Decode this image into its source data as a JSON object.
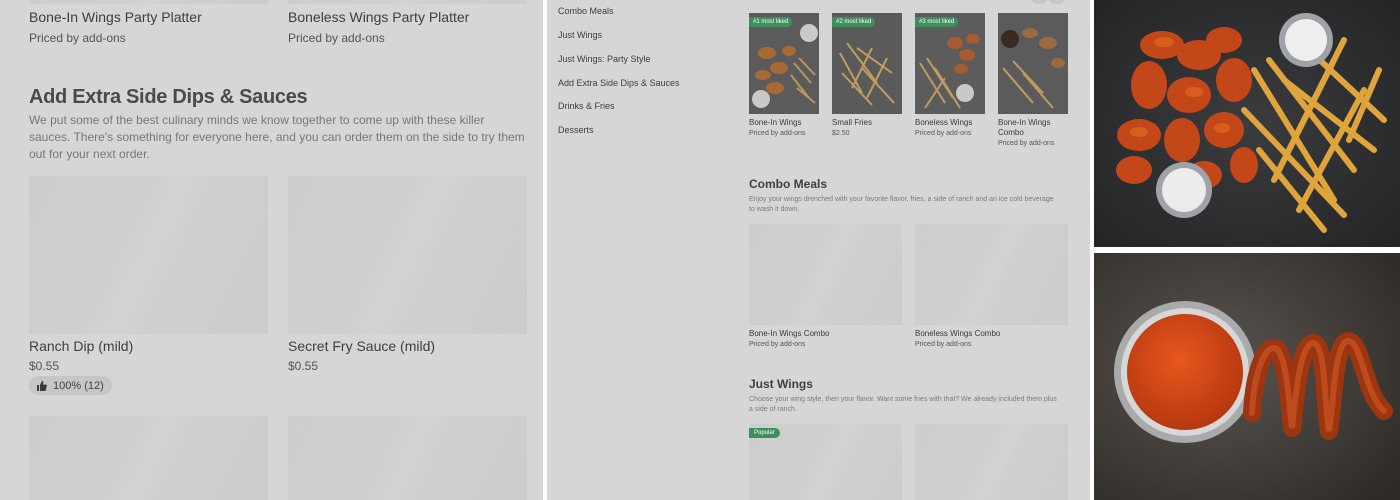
{
  "panel_a": {
    "top_items": [
      {
        "name": "Bone-In Wings Party Platter",
        "price": "Priced by add-ons"
      },
      {
        "name": "Boneless Wings Party Platter",
        "price": "Priced by add-ons"
      }
    ],
    "section_title": "Add Extra Side Dips & Sauces",
    "section_desc": "We put some of the best culinary minds we know together to come up with these killer sauces. There's something for everyone here, and you can order them on the side to try them out for your next order.",
    "items": [
      {
        "name": "Ranch Dip (mild)",
        "price": "$0.55",
        "rating": "100% (12)"
      },
      {
        "name": "Secret Fry Sauce (mild)",
        "price": "$0.55"
      }
    ]
  },
  "panel_b": {
    "nav": [
      "Combo Meals",
      "Just Wings",
      "Just Wings: Party Style",
      "Add Extra Side Dips & Sauces",
      "Drinks & Fries",
      "Desserts"
    ],
    "featured": [
      {
        "tag": "#1 most liked",
        "name": "Bone-In Wings",
        "price": "Priced by add-ons"
      },
      {
        "tag": "#2 most liked",
        "name": "Small Fries",
        "price": "$2.50"
      },
      {
        "tag": "#3 most liked",
        "name": "Boneless Wings",
        "price": "Priced by add-ons"
      },
      {
        "name": "Bone-In Wings Combo",
        "price": "Priced by add-ons"
      }
    ],
    "combo": {
      "title": "Combo Meals",
      "desc": "Enjoy your wings drenched with your favorite flavor, fries, a side of ranch and an ice cold beverage to wash it down.",
      "items": [
        {
          "name": "Bone-In Wings Combo",
          "price": "Priced by add-ons"
        },
        {
          "name": "Boneless Wings Combo",
          "price": "Priced by add-ons"
        }
      ]
    },
    "just_wings": {
      "title": "Just Wings",
      "desc": "Choose your wing style, then your flavor. Want some fries with that? We already included them plus a side of ranch.",
      "badge": "Popular"
    }
  },
  "colors": {
    "badge_green": "#3f8f5c",
    "dim_bg": "#d6d6d6",
    "sauce_red": "#c43a10"
  }
}
